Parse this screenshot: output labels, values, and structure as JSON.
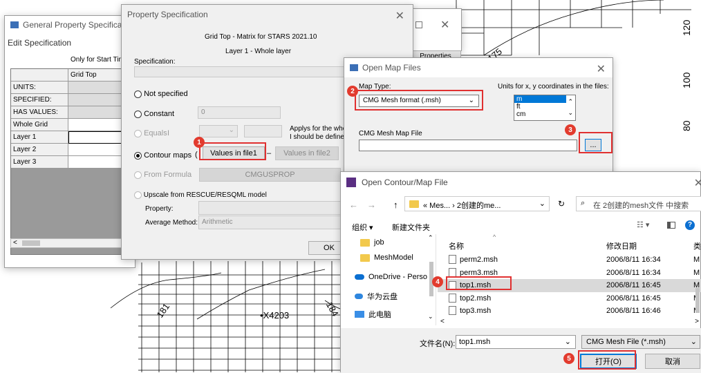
{
  "background_map": {
    "axis_labels": [
      "120",
      "100",
      "80"
    ],
    "contour_labels": [
      "181",
      "184",
      "175"
    ],
    "well_label": "X4203"
  },
  "general_window": {
    "title": "General Property Specificatio",
    "menu": "Edit Specification",
    "only_for": "Only for Start Time",
    "grid_header": "Grid Top",
    "rows": [
      "UNITS:",
      "SPECIFIED:",
      "HAS VALUES:",
      "Whole Grid",
      "Layer 1",
      "Layer 2",
      "Layer 3"
    ],
    "scroll_left": "<"
  },
  "back_window": {
    "properties_btn": "Properties"
  },
  "prop_spec": {
    "title": "Property Specification",
    "subtitle": "Grid Top - Matrix for STARS 2021.10",
    "layer": "Layer 1 - Whole layer",
    "spec_label": "Specification:",
    "not_specified": "Not specified",
    "constant": "Constant",
    "constant_value": "0",
    "equals": "Equals",
    "equals_i": "I",
    "applys_text": "Applys for the who",
    "defined_text": "I should be defined",
    "contour_maps": "Contour maps",
    "paren": "(",
    "values_file1": "Values in file1",
    "dash": "–",
    "values_file2": "Values in file2",
    "from_formula": "From Formula",
    "formula_btn": "CMGUSPROP",
    "upscale": "Upscale from RESCUE/RESQML model",
    "property_label": "Property:",
    "avg_label": "Average Method:",
    "avg_value": "Arithmetic",
    "ok": "OK"
  },
  "open_map": {
    "title": "Open Map Files",
    "map_type_label": "Map Type:",
    "map_type_value": "CMG Mesh format  (.msh)",
    "units_label": "Units for x, y coordinates in the files:",
    "units": [
      "m",
      "ft",
      "cm"
    ],
    "mesh_file_label": "CMG Mesh Map File",
    "browse": "..."
  },
  "open_contour": {
    "title": "Open Contour/Map File",
    "breadcrumb": "«  Mes...  ›  2创建的me...",
    "search_placeholder": "在 2创建的mesh文件 中搜索",
    "organize": "组织 ▾",
    "new_folder": "新建文件夹",
    "nav": [
      "job",
      "MeshModel",
      "OneDrive - Perso",
      "华为云盘",
      "此电脑"
    ],
    "col_name": "名称",
    "col_date": "修改日期",
    "col_type": "类",
    "files": [
      {
        "name": "perm2.msh",
        "date": "2006/8/11 16:34",
        "type": "M"
      },
      {
        "name": "perm3.msh",
        "date": "2006/8/11 16:34",
        "type": "M"
      },
      {
        "name": "top1.msh",
        "date": "2006/8/11 16:45",
        "type": "M"
      },
      {
        "name": "top2.msh",
        "date": "2006/8/11 16:45",
        "type": "M"
      },
      {
        "name": "top3.msh",
        "date": "2006/8/11 16:46",
        "type": "M"
      }
    ],
    "filename_label": "文件名(N):",
    "filename_value": "top1.msh",
    "filter": "CMG Mesh File (*.msh)",
    "open_btn": "打开(O)",
    "cancel_btn": "取消"
  },
  "badges": [
    "1",
    "2",
    "3",
    "4",
    "5"
  ],
  "colors": {
    "highlight": "#e03030",
    "selection": "#0078d7",
    "badge": "#e23b2e"
  }
}
